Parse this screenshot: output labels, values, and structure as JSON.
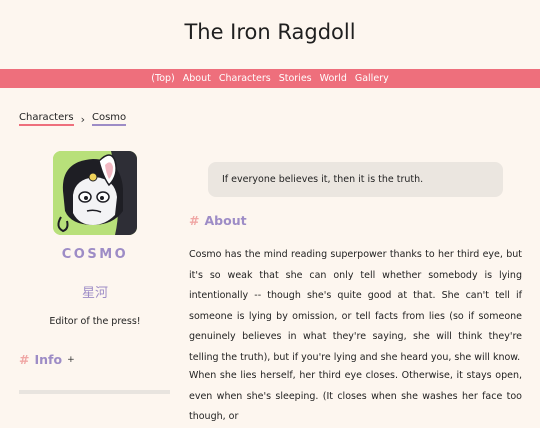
{
  "site": {
    "title": "The Iron Ragdoll"
  },
  "nav": {
    "items": [
      "(Top)",
      "About",
      "Characters",
      "Stories",
      "World",
      "Gallery"
    ]
  },
  "breadcrumb": {
    "parent": "Characters",
    "separator": "›",
    "current": "Cosmo"
  },
  "character": {
    "name": "COSMO",
    "name_cn": "星河",
    "role": "Editor of the press!"
  },
  "info": {
    "hash": "#",
    "heading": "Info",
    "toggle": "+"
  },
  "quote": "If everyone believes it, then it is the truth.",
  "about": {
    "hash": "#",
    "heading": "About",
    "paragraphs": [
      "Cosmo has the mind reading superpower thanks to her third eye, but it's so weak that she can only tell whether somebody is lying intentionally -- though she's quite good at that. She can't tell if someone is lying by omission, or tell facts from lies (so if someone genuinely believes in what they're saying, she will think they're telling the truth), but if you're lying and she heard you, she will know.",
      "When she lies herself, her third eye closes. Otherwise, it stays open, even when she's sleeping. (It closes when she washes her face too though, or"
    ]
  },
  "colors": {
    "nav_bg": "#ee6f7c",
    "accent_purple": "#9d8cc6",
    "accent_pink": "#f0a7a5",
    "page_bg": "#fdf6ef",
    "quote_bg": "#ebe6e0",
    "avatar_bg": "#b8e07a"
  }
}
